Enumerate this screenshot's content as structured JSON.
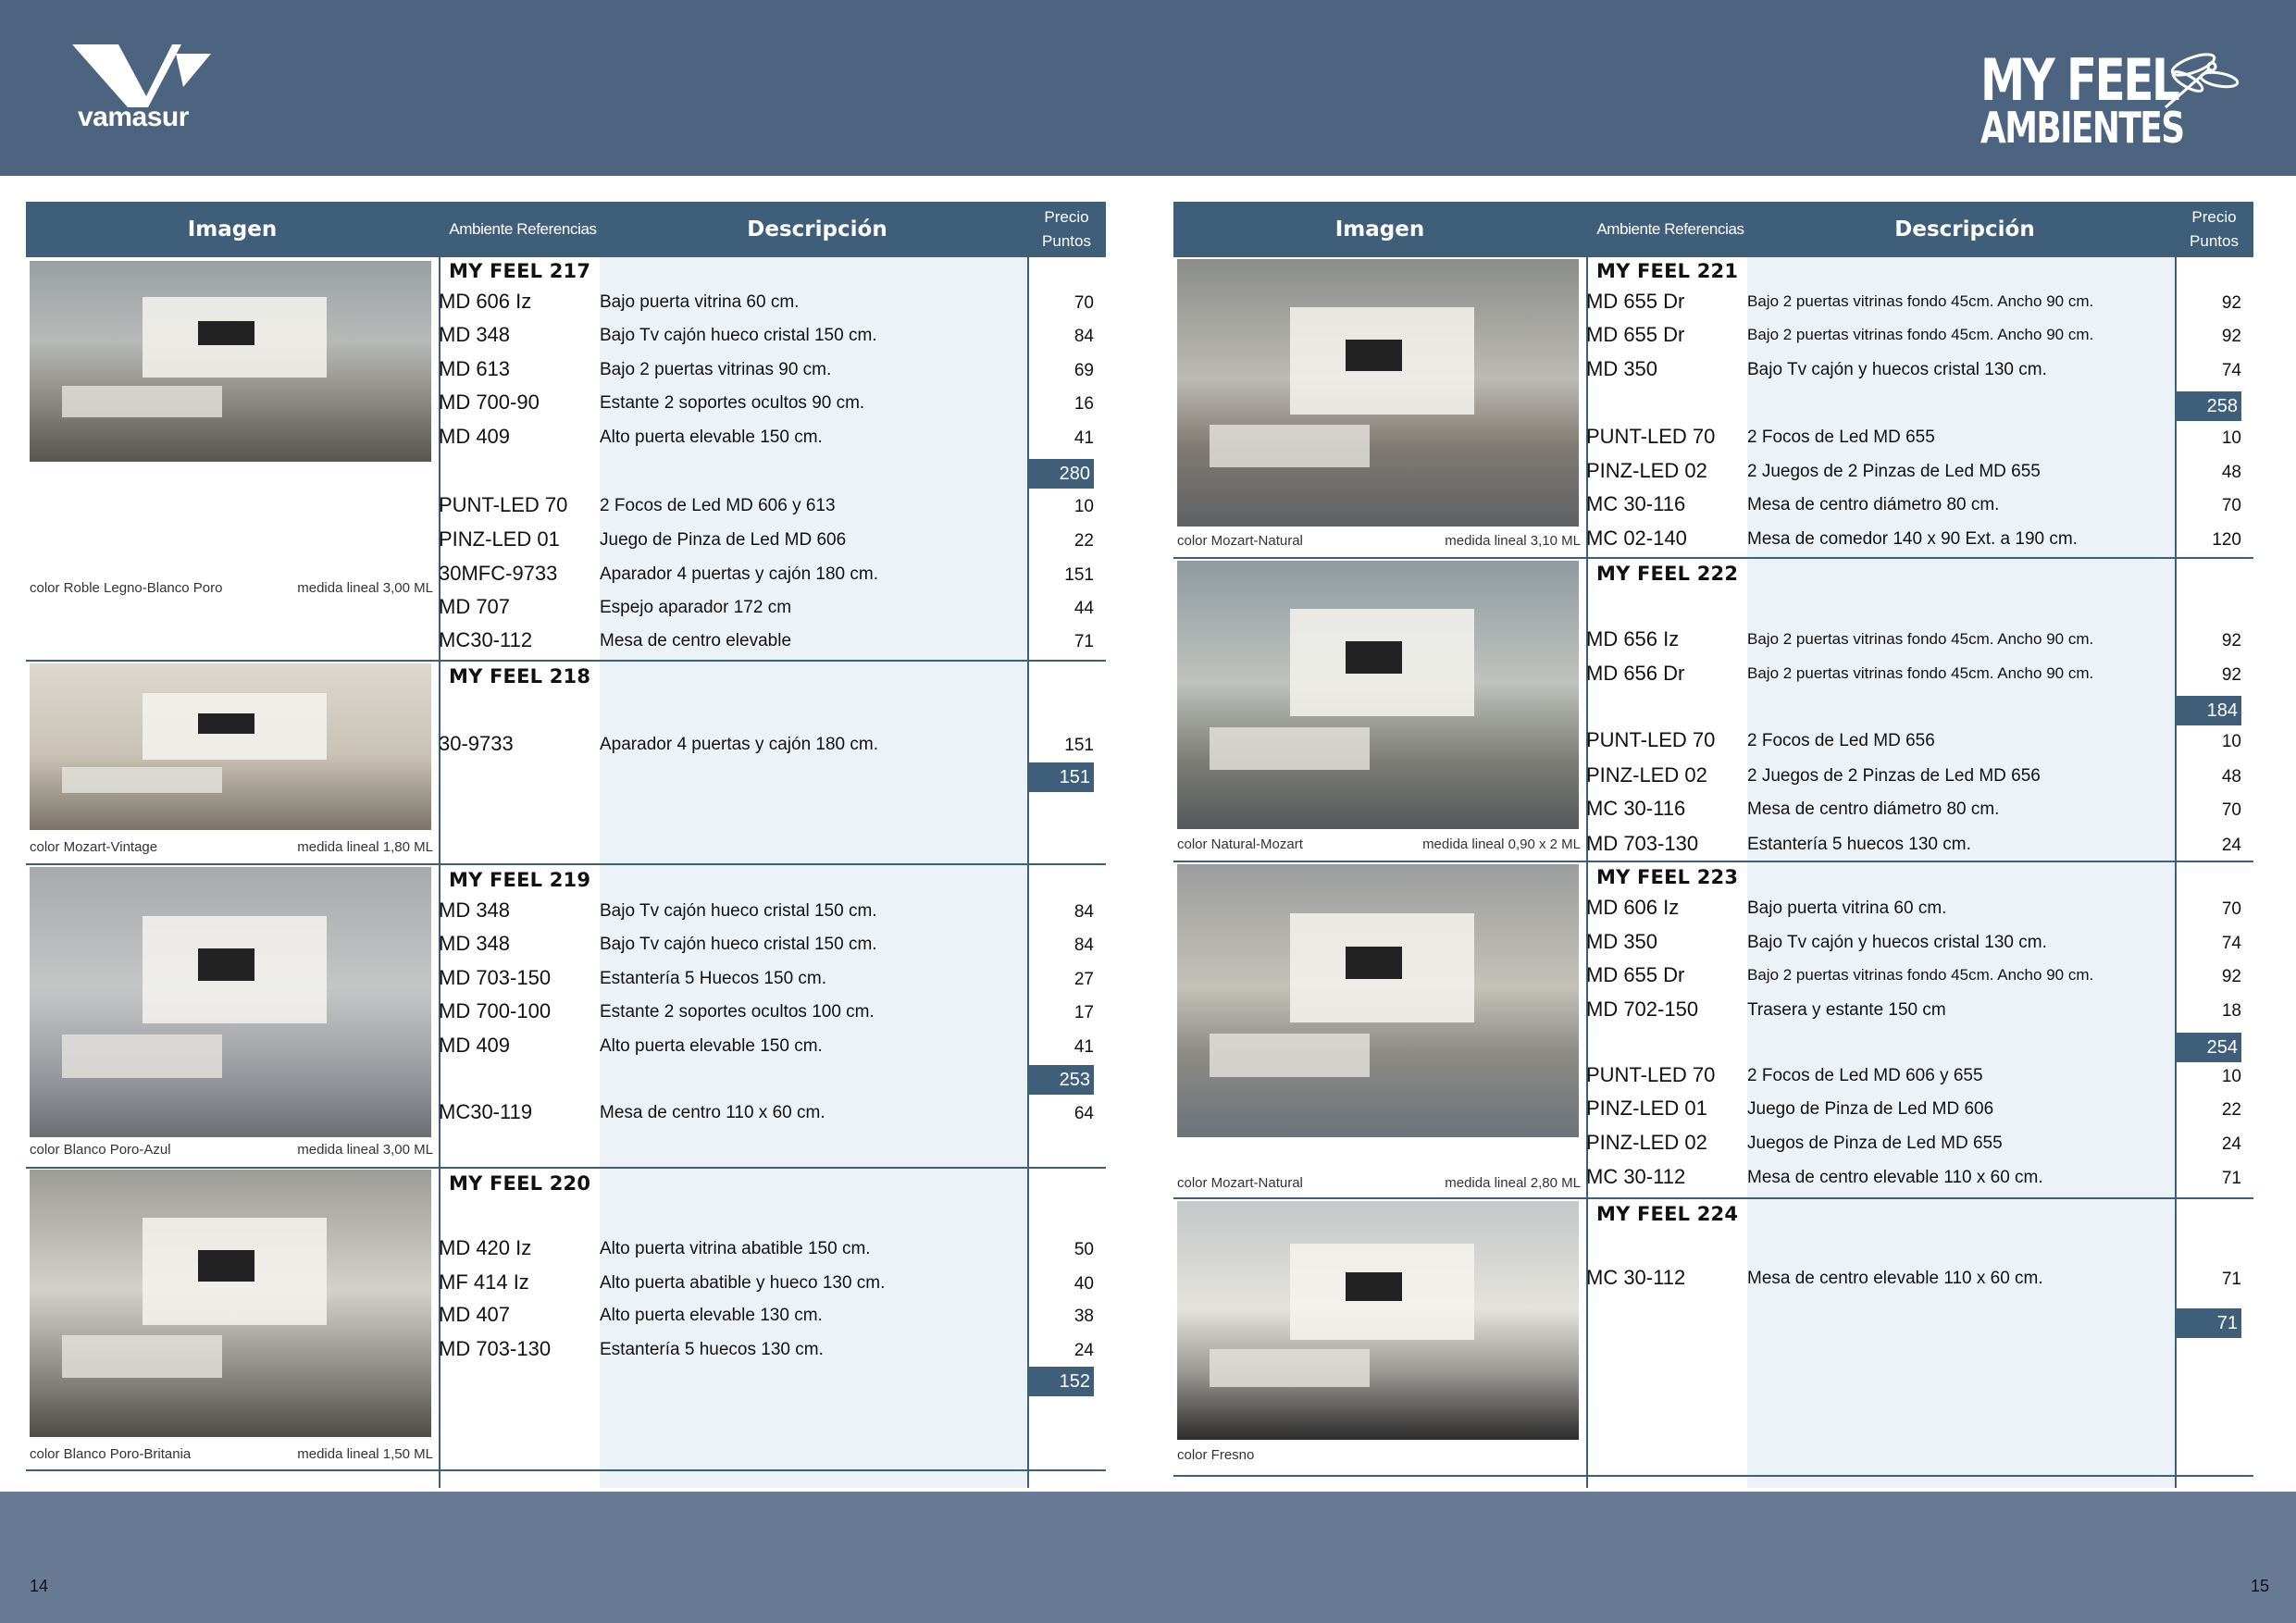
{
  "brand": {
    "logo_text": "vamasur",
    "line1": "MY FEEL",
    "line2": "AMBIENTES"
  },
  "page_numbers": {
    "left": "14",
    "right": "15"
  },
  "headers": {
    "image": "Imagen",
    "refs": "Ambiente Referencias",
    "desc": "Descripción",
    "price1": "Precio",
    "price2": "Puntos"
  },
  "left": [
    {
      "title": "MY FEEL 217",
      "color": "color Roble Legno-Blanco Poro",
      "medida": "medida lineal 3,00 ML",
      "total": "280",
      "items": [
        {
          "ref": "MD 606 Iz",
          "desc": "Bajo puerta vitrina 60 cm.",
          "price": "70"
        },
        {
          "ref": "MD 348",
          "desc": "Bajo Tv cajón hueco cristal 150 cm.",
          "price": "84"
        },
        {
          "ref": "MD 613",
          "desc": "Bajo 2 puertas vitrinas 90 cm.",
          "price": "69"
        },
        {
          "ref": "MD 700-90",
          "desc": "Estante 2 soportes ocultos 90 cm.",
          "price": "16"
        },
        {
          "ref": "MD 409",
          "desc": "Alto puerta elevable 150 cm.",
          "price": "41"
        },
        {
          "ref": "PUNT-LED 70",
          "desc": "2 Focos de Led MD 606 y 613",
          "price": "10"
        },
        {
          "ref": "PINZ-LED 01",
          "desc": "Juego de Pinza de Led MD 606",
          "price": "22"
        },
        {
          "ref": "30MFC-9733",
          "desc": "Aparador 4 puertas y  cajón 180 cm.",
          "price": "151"
        },
        {
          "ref": "MD 707",
          "desc": "Espejo aparador 172 cm",
          "price": "44"
        },
        {
          "ref": "MC30-112",
          "desc": "Mesa de centro elevable",
          "price": "71"
        }
      ]
    },
    {
      "title": "MY FEEL 218",
      "color": "color Mozart-Vintage",
      "medida": "medida lineal 1,80 ML",
      "total": "151",
      "items": [
        {
          "ref": "30-9733",
          "desc": "Aparador 4 puertas y cajón 180 cm.",
          "price": "151"
        }
      ]
    },
    {
      "title": "MY FEEL 219",
      "color": "color Blanco Poro-Azul",
      "medida": "medida lineal 3,00 ML",
      "total": "253",
      "items": [
        {
          "ref": "MD 348",
          "desc": "Bajo Tv cajón hueco cristal 150 cm.",
          "price": "84"
        },
        {
          "ref": "MD 348",
          "desc": "Bajo Tv cajón hueco cristal 150 cm.",
          "price": "84"
        },
        {
          "ref": "MD 703-150",
          "desc": "Estantería 5 Huecos 150 cm.",
          "price": "27"
        },
        {
          "ref": "MD 700-100",
          "desc": "Estante 2 soportes ocultos 100 cm.",
          "price": "17"
        },
        {
          "ref": "MD 409",
          "desc": "Alto puerta elevable 150 cm.",
          "price": "41"
        },
        {
          "ref": "MC30-119",
          "desc": "Mesa de centro 110 x 60 cm.",
          "price": "64"
        }
      ]
    },
    {
      "title": "MY FEEL 220",
      "color": "color Blanco Poro-Britania",
      "medida": "medida lineal 1,50 ML",
      "total": "152",
      "items": [
        {
          "ref": "MD 420 Iz",
          "desc": "Alto puerta vitrina abatible 150 cm.",
          "price": "50"
        },
        {
          "ref": "MF 414 Iz",
          "desc": "Alto puerta abatible y hueco 130 cm.",
          "price": "40"
        },
        {
          "ref": "MD 407",
          "desc": "Alto puerta elevable 130 cm.",
          "price": "38"
        },
        {
          "ref": "MD 703-130",
          "desc": "Estantería 5 huecos 130 cm.",
          "price": "24"
        }
      ]
    }
  ],
  "right": [
    {
      "title": "MY FEEL 221",
      "color": "color Mozart-Natural",
      "medida": "medida lineal 3,10 ML",
      "total": "258",
      "items": [
        {
          "ref": "MD 655 Dr",
          "desc": "Bajo 2 puertas vitrinas fondo 45cm. Ancho 90 cm.",
          "price": "92"
        },
        {
          "ref": "MD 655 Dr",
          "desc": "Bajo 2 puertas vitrinas fondo 45cm. Ancho 90 cm.",
          "price": "92"
        },
        {
          "ref": "MD 350",
          "desc": "Bajo Tv cajón y huecos cristal 130 cm.",
          "price": "74"
        },
        {
          "ref": "PUNT-LED 70",
          "desc": "2 Focos de Led MD 655",
          "price": "10"
        },
        {
          "ref": "PINZ-LED 02",
          "desc": "2 Juegos de 2 Pinzas de Led MD 655",
          "price": "48"
        },
        {
          "ref": "MC 30-116",
          "desc": "Mesa de centro diámetro 80 cm.",
          "price": "70"
        },
        {
          "ref": "MC 02-140",
          "desc": "Mesa de comedor 140 x 90 Ext. a 190 cm.",
          "price": "120"
        }
      ]
    },
    {
      "title": "MY FEEL 222",
      "color": "color Natural-Mozart",
      "medida": "medida lineal 0,90 x 2 ML",
      "total": "184",
      "items": [
        {
          "ref": "MD 656 Iz",
          "desc": "Bajo 2 puertas vitrinas fondo 45cm. Ancho 90 cm.",
          "price": "92"
        },
        {
          "ref": "MD 656 Dr",
          "desc": "Bajo 2 puertas vitrinas fondo 45cm. Ancho 90 cm.",
          "price": "92"
        },
        {
          "ref": "PUNT-LED 70",
          "desc": "2 Focos de Led MD 656",
          "price": "10"
        },
        {
          "ref": "PINZ-LED 02",
          "desc": "2 Juegos de 2 Pinzas de Led MD 656",
          "price": "48"
        },
        {
          "ref": "MC 30-116",
          "desc": "Mesa de centro diámetro 80 cm.",
          "price": "70"
        },
        {
          "ref": "MD 703-130",
          "desc": "Estantería 5 huecos 130 cm.",
          "price": "24"
        }
      ]
    },
    {
      "title": "MY FEEL 223",
      "color": "color Mozart-Natural",
      "medida": "medida lineal 2,80 ML",
      "total": "254",
      "items": [
        {
          "ref": "MD 606 Iz",
          "desc": "Bajo puerta vitrina 60 cm.",
          "price": "70"
        },
        {
          "ref": "MD 350",
          "desc": "Bajo Tv cajón y huecos cristal 130 cm.",
          "price": "74"
        },
        {
          "ref": "MD 655 Dr",
          "desc": "Bajo 2 puertas vitrinas fondo 45cm. Ancho 90 cm.",
          "price": "92"
        },
        {
          "ref": "MD 702-150",
          "desc": "Trasera y estante 150 cm",
          "price": "18"
        },
        {
          "ref": "PUNT-LED 70",
          "desc": "2 Focos de Led MD 606 y 655",
          "price": "10"
        },
        {
          "ref": "PINZ-LED 01",
          "desc": "Juego de Pinza de Led MD 606",
          "price": "22"
        },
        {
          "ref": "PINZ-LED 02",
          "desc": "Juegos de Pinza de Led MD 655",
          "price": "24"
        },
        {
          "ref": "MC 30-112",
          "desc": "Mesa de centro elevable 110 x 60 cm.",
          "price": "71"
        }
      ]
    },
    {
      "title": "MY FEEL 224",
      "color": "color Fresno",
      "medida": "",
      "total": "71",
      "items": [
        {
          "ref": "MC 30-112",
          "desc": "Mesa de centro elevable 110 x 60 cm.",
          "price": "71"
        }
      ]
    }
  ]
}
